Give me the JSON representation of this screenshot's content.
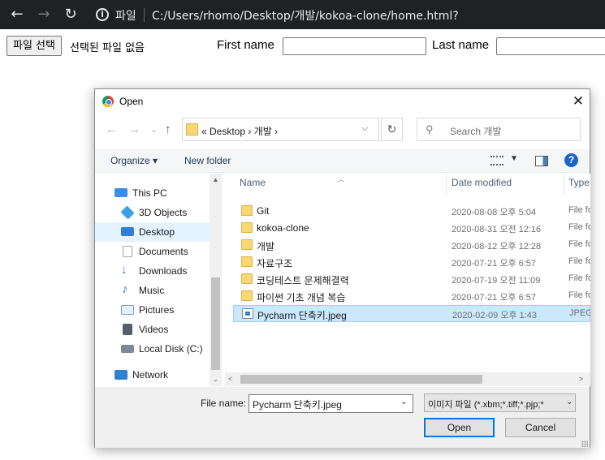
{
  "browser": {
    "back_icon": "arrow-left",
    "forward_icon": "arrow-right",
    "reload_icon": "reload",
    "info_icon": "info",
    "scheme_label": "파일",
    "url": "C:/Users/rhomo/Desktop/개발/kokoa-clone/home.html?"
  },
  "page": {
    "file_button_label": "파일 선택",
    "no_file_text": "선택된 파일 없음",
    "first_name_label": "First name",
    "first_name_value": "",
    "last_name_label": "Last name",
    "last_name_value": ""
  },
  "dialog": {
    "title": "Open",
    "close_glyph": "✕",
    "address": {
      "breadcrumb": "«  Desktop  ›  개발  ›",
      "back_glyph": "←",
      "forward_glyph": "→",
      "recent_glyph": "⌄",
      "up_glyph": "↑",
      "dropdown_glyph": "⌵",
      "refresh_glyph": "↻"
    },
    "search_glyph": "⚲",
    "search_placeholder": "Search 개발",
    "toolbar": {
      "organize_label": "Organize ▾",
      "new_folder_label": "New folder",
      "view_dropdown_glyph": "▼",
      "help_glyph": "?"
    },
    "nav_items": [
      {
        "label": "This PC",
        "icon": "pc-icon",
        "color": "#3a8ee6"
      },
      {
        "label": "3D Objects",
        "icon": "cube-icon",
        "color": "#39a0e8"
      },
      {
        "label": "Desktop",
        "icon": "desktop-icon",
        "color": "#2f7fd8"
      },
      {
        "label": "Documents",
        "icon": "document-icon",
        "color": "#9aa6b5"
      },
      {
        "label": "Downloads",
        "icon": "download-icon",
        "color": "#2b79d4"
      },
      {
        "label": "Music",
        "icon": "music-icon",
        "color": "#2d7fd6"
      },
      {
        "label": "Pictures",
        "icon": "pictures-icon",
        "color": "#7aa0c8"
      },
      {
        "label": "Videos",
        "icon": "video-icon",
        "color": "#555e6b"
      },
      {
        "label": "Local Disk (C:)",
        "icon": "disk-icon",
        "color": "#7d8a99"
      },
      {
        "label": "Network",
        "icon": "network-icon",
        "color": "#2f80d0"
      }
    ],
    "nav_scroll": {
      "up_glyph": "▲",
      "down_glyph": "⌄"
    },
    "columns": {
      "name": "Name",
      "date": "Date modified",
      "type": "Type",
      "sort_glyph": "︿"
    },
    "files": [
      {
        "name": "Git",
        "date": "2020-08-08 오후 5:04",
        "type": "File fo",
        "kind": "folder"
      },
      {
        "name": "kokoa-clone",
        "date": "2020-08-31 오전 12:16",
        "type": "File fo",
        "kind": "folder"
      },
      {
        "name": "개발",
        "date": "2020-08-12 오후 12:28",
        "type": "File fo",
        "kind": "folder"
      },
      {
        "name": "자료구조",
        "date": "2020-07-21 오후 6:57",
        "type": "File fo",
        "kind": "folder"
      },
      {
        "name": "코딩테스트 문제해결력",
        "date": "2020-07-19 오전 11:09",
        "type": "File fo",
        "kind": "folder"
      },
      {
        "name": "파이썬 기초 개념 복습",
        "date": "2020-07-21 오후 6:57",
        "type": "File fo",
        "kind": "folder"
      },
      {
        "name": "Pycharm 단축키.jpeg",
        "date": "2020-02-09 오후 1:43",
        "type": "JPEG",
        "kind": "jpeg",
        "selected": true
      }
    ],
    "hscroll": {
      "left_glyph": "<",
      "right_glyph": ">"
    },
    "file_name_label": "File name:",
    "file_name_value": "Pycharm 단축키.jpeg",
    "file_name_dropdown_glyph": "⌄",
    "file_type_value": "이미지 파일 (*.xbm;*.tiff;*.pjp;*",
    "file_type_dropdown_glyph": "⌄",
    "open_label": "Open",
    "cancel_label": "Cancel"
  }
}
